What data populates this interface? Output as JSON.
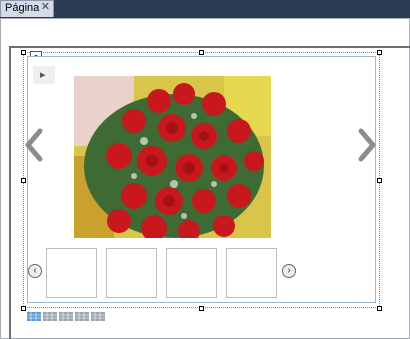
{
  "tab": {
    "label": "Página",
    "close_glyph": "✕"
  },
  "carousel": {
    "prev_icon": "chevron-left-icon",
    "next_icon": "chevron-right-icon",
    "prev_glyph": "‹",
    "next_glyph": "›",
    "thumb_prev_glyph": "‹",
    "thumb_next_glyph": "›",
    "small_nav_glyph": "▸",
    "thumbnails": [
      "",
      "",
      "",
      ""
    ]
  }
}
